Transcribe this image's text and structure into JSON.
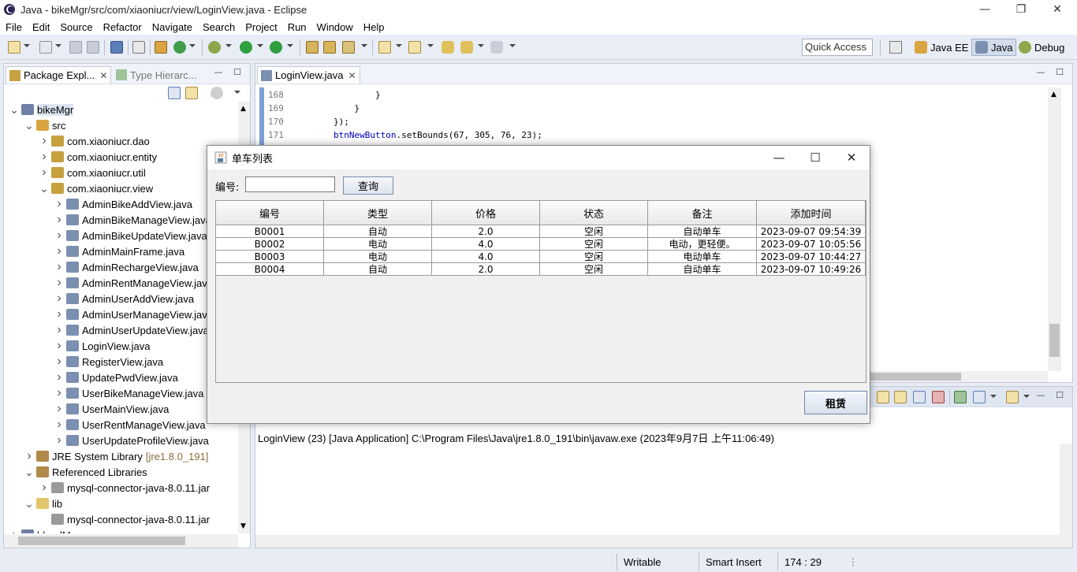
{
  "window": {
    "title": "Java - bikeMgr/src/com/xiaoniucr/view/LoginView.java - Eclipse"
  },
  "menu": [
    "File",
    "Edit",
    "Source",
    "Refactor",
    "Navigate",
    "Search",
    "Project",
    "Run",
    "Window",
    "Help"
  ],
  "toolbar": {
    "quick_access": "Quick Access",
    "perspectives": {
      "java_ee": "Java EE",
      "java": "Java",
      "debug": "Debug"
    }
  },
  "package_explorer": {
    "tab_label": "Package Expl...",
    "type_hierarchy_tab": "Type Hierarc...",
    "tree": [
      {
        "depth": 0,
        "arrow": "expanded",
        "icon": "project",
        "label": "bikeMgr",
        "selected": true
      },
      {
        "depth": 1,
        "arrow": "expanded",
        "icon": "source-folder",
        "label": "src"
      },
      {
        "depth": 2,
        "arrow": "collapsed",
        "icon": "package",
        "label": "com.xiaoniucr.dao"
      },
      {
        "depth": 2,
        "arrow": "collapsed",
        "icon": "package",
        "label": "com.xiaoniucr.entity"
      },
      {
        "depth": 2,
        "arrow": "collapsed",
        "icon": "package",
        "label": "com.xiaoniucr.util"
      },
      {
        "depth": 2,
        "arrow": "expanded",
        "icon": "package",
        "label": "com.xiaoniucr.view"
      },
      {
        "depth": 3,
        "arrow": "collapsed",
        "icon": "java-file",
        "label": "AdminBikeAddView.java"
      },
      {
        "depth": 3,
        "arrow": "collapsed",
        "icon": "java-file",
        "label": "AdminBikeManageView.java"
      },
      {
        "depth": 3,
        "arrow": "collapsed",
        "icon": "java-file",
        "label": "AdminBikeUpdateView.java"
      },
      {
        "depth": 3,
        "arrow": "collapsed",
        "icon": "java-file",
        "label": "AdminMainFrame.java"
      },
      {
        "depth": 3,
        "arrow": "collapsed",
        "icon": "java-file",
        "label": "AdminRechargeView.java"
      },
      {
        "depth": 3,
        "arrow": "collapsed",
        "icon": "java-file",
        "label": "AdminRentManageView.java"
      },
      {
        "depth": 3,
        "arrow": "collapsed",
        "icon": "java-file",
        "label": "AdminUserAddView.java"
      },
      {
        "depth": 3,
        "arrow": "collapsed",
        "icon": "java-file",
        "label": "AdminUserManageView.java"
      },
      {
        "depth": 3,
        "arrow": "collapsed",
        "icon": "java-file",
        "label": "AdminUserUpdateView.java"
      },
      {
        "depth": 3,
        "arrow": "collapsed",
        "icon": "java-file",
        "label": "LoginView.java"
      },
      {
        "depth": 3,
        "arrow": "collapsed",
        "icon": "java-file",
        "label": "RegisterView.java"
      },
      {
        "depth": 3,
        "arrow": "collapsed",
        "icon": "java-file",
        "label": "UpdatePwdView.java"
      },
      {
        "depth": 3,
        "arrow": "collapsed",
        "icon": "java-file",
        "label": "UserBikeManageView.java"
      },
      {
        "depth": 3,
        "arrow": "collapsed",
        "icon": "java-file",
        "label": "UserMainView.java"
      },
      {
        "depth": 3,
        "arrow": "collapsed",
        "icon": "java-file",
        "label": "UserRentManageView.java"
      },
      {
        "depth": 3,
        "arrow": "collapsed",
        "icon": "java-file",
        "label": "UserUpdateProfileView.java"
      },
      {
        "depth": 1,
        "arrow": "collapsed",
        "icon": "library",
        "label": "JRE System Library",
        "extra": "[jre1.8.0_191]"
      },
      {
        "depth": 1,
        "arrow": "expanded",
        "icon": "library",
        "label": "Referenced Libraries"
      },
      {
        "depth": 2,
        "arrow": "collapsed",
        "icon": "jar",
        "label": "mysql-connector-java-8.0.11.jar"
      },
      {
        "depth": 1,
        "arrow": "expanded",
        "icon": "folder",
        "label": "lib"
      },
      {
        "depth": 2,
        "arrow": "none",
        "icon": "jar",
        "label": "mysql-connector-java-8.0.11.jar"
      },
      {
        "depth": 0,
        "arrow": "collapsed",
        "icon": "project",
        "label": "bloodMgr"
      }
    ]
  },
  "editor": {
    "tab_label": "LoginView.java",
    "lines": [
      {
        "num": "168",
        "code": "                }",
        "field": "",
        "rest": ""
      },
      {
        "num": "169",
        "code": "            }",
        "field": "",
        "rest": ""
      },
      {
        "num": "170",
        "code": "        });",
        "field": "",
        "rest": ""
      },
      {
        "num": "171",
        "code": "        ",
        "field": "btnNewButton",
        "rest": ".setBounds(67, 305, 76, 23);"
      }
    ]
  },
  "console": {
    "launch_text": "LoginView (23) [Java Application] C:\\Program Files\\Java\\jre1.8.0_191\\bin\\javaw.exe (2023年9月7日 上午11:06:49)"
  },
  "statusbar": {
    "writable": "Writable",
    "insert_mode": "Smart Insert",
    "position": "174 : 29"
  },
  "dialog": {
    "title": "单车列表",
    "id_label": "编号:",
    "id_value": "",
    "query_button": "查询",
    "rent_button": "租赁",
    "table": {
      "columns": [
        "编号",
        "类型",
        "价格",
        "状态",
        "备注",
        "添加时间"
      ],
      "rows": [
        [
          "B0001",
          "自动",
          "2.0",
          "空闲",
          "自动单车",
          "2023-09-07 09:54:39"
        ],
        [
          "B0002",
          "电动",
          "4.0",
          "空闲",
          "电动，更轻便。",
          "2023-09-07 10:05:56"
        ],
        [
          "B0003",
          "电动",
          "4.0",
          "空闲",
          "电动单车",
          "2023-09-07 10:44:27"
        ],
        [
          "B0004",
          "自动",
          "2.0",
          "空闲",
          "自动单车",
          "2023-09-07 10:49:26"
        ]
      ]
    }
  },
  "colors": {
    "package": "#c8a040",
    "java_file": "#7b8fb0",
    "gutter": "#7fa0d6",
    "field": "#0000c0"
  }
}
